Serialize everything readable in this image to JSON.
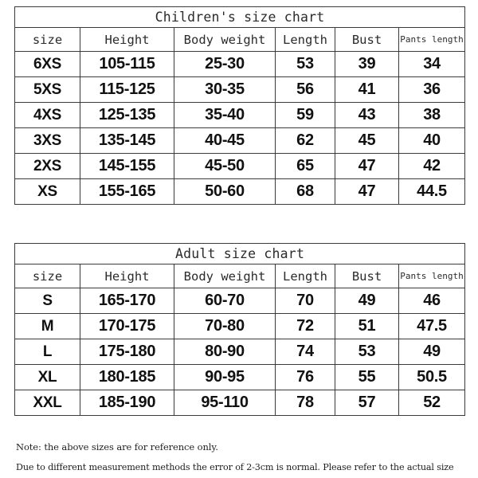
{
  "document": {
    "type": "size-chart",
    "background_color": "#ffffff",
    "text_color": "#111111",
    "border_color": "#3a3a3a"
  },
  "columns": {
    "size": "size",
    "height": "Height",
    "body_weight": "Body weight",
    "length": "Length",
    "bust": "Bust",
    "pants_length": "Pants length"
  },
  "children_table": {
    "title": "Children's size chart",
    "headers": [
      "size",
      "Height",
      "Body weight",
      "Length",
      "Bust",
      "Pants length"
    ],
    "rows": [
      {
        "size": "6XS",
        "height": "105-115",
        "body_weight": "25-30",
        "length": "53",
        "bust": "39",
        "pants_length": "34"
      },
      {
        "size": "5XS",
        "height": "115-125",
        "body_weight": "30-35",
        "length": "56",
        "bust": "41",
        "pants_length": "36"
      },
      {
        "size": "4XS",
        "height": "125-135",
        "body_weight": "35-40",
        "length": "59",
        "bust": "43",
        "pants_length": "38"
      },
      {
        "size": "3XS",
        "height": "135-145",
        "body_weight": "40-45",
        "length": "62",
        "bust": "45",
        "pants_length": "40"
      },
      {
        "size": "2XS",
        "height": "145-155",
        "body_weight": "45-50",
        "length": "65",
        "bust": "47",
        "pants_length": "42"
      },
      {
        "size": "XS",
        "height": "155-165",
        "body_weight": "50-60",
        "length": "68",
        "bust": "47",
        "pants_length": "44.5"
      }
    ]
  },
  "adult_table": {
    "title": "Adult size chart",
    "headers": [
      "size",
      "Height",
      "Body weight",
      "Length",
      "Bust",
      "Pants length"
    ],
    "rows": [
      {
        "size": "S",
        "height": "165-170",
        "body_weight": "60-70",
        "length": "70",
        "bust": "49",
        "pants_length": "46"
      },
      {
        "size": "M",
        "height": "170-175",
        "body_weight": "70-80",
        "length": "72",
        "bust": "51",
        "pants_length": "47.5"
      },
      {
        "size": "L",
        "height": "175-180",
        "body_weight": "80-90",
        "length": "74",
        "bust": "53",
        "pants_length": "49"
      },
      {
        "size": "XL",
        "height": "180-185",
        "body_weight": "90-95",
        "length": "76",
        "bust": "55",
        "pants_length": "50.5"
      },
      {
        "size": "XXL",
        "height": "185-190",
        "body_weight": "95-110",
        "length": "78",
        "bust": "57",
        "pants_length": "52"
      }
    ]
  },
  "notes": {
    "line1": "Note: the above sizes are for reference only.",
    "line2": "Due to different measurement methods the error of 2-3cm is normal. Please refer to the actual size"
  }
}
